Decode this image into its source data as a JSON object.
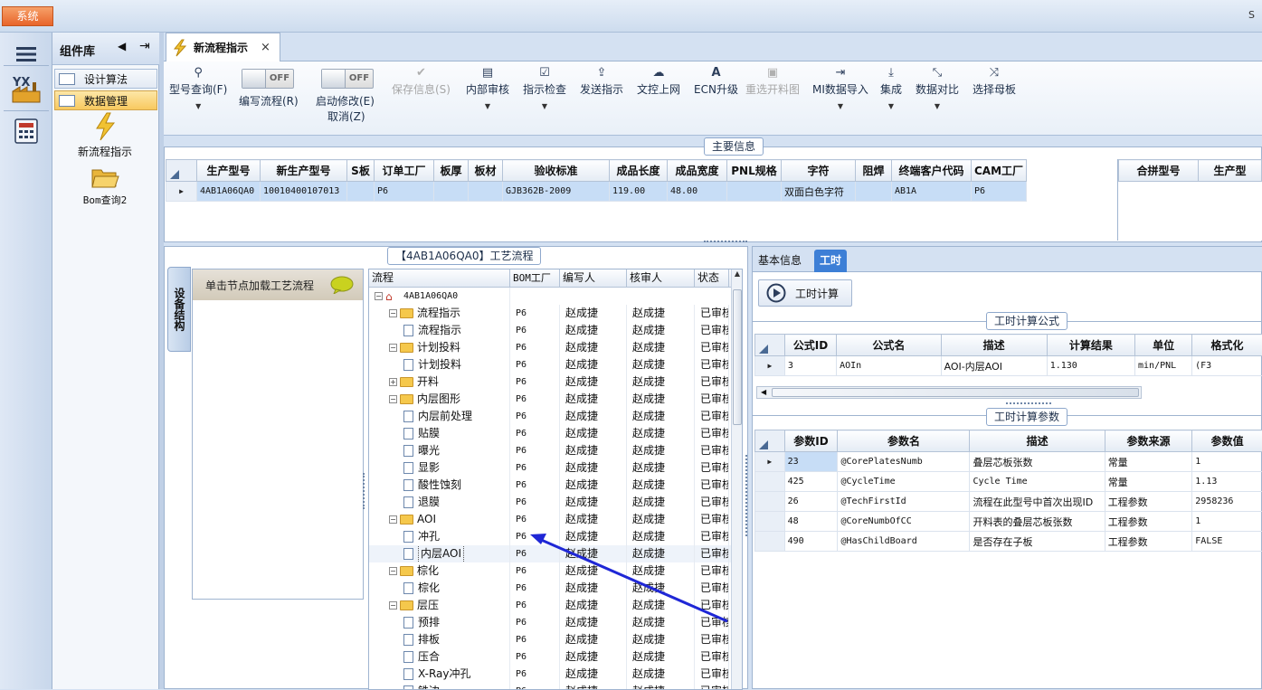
{
  "app": {
    "system_button": "系统",
    "corner_text": "S"
  },
  "component_panel": {
    "title": "组件库",
    "menu": [
      {
        "label": "设计算法"
      },
      {
        "label": "数据管理"
      }
    ],
    "desktop_items": [
      {
        "label": "新流程指示"
      },
      {
        "label": "Bom查询2"
      }
    ]
  },
  "document_tab": {
    "title": "新流程指示",
    "close": "×"
  },
  "toolbar": {
    "model_query": "型号查询(F)",
    "edit_flow": "编写流程(R)",
    "edit_flow_toggle": "OFF",
    "start_modify": "启动修改(E)",
    "start_modify_toggle": "OFF",
    "cancel": "取消(Z)",
    "save_info": "保存信息(S)",
    "internal_review": "内部审核",
    "instruction_check": "指示检查",
    "send_instruction": "发送指示",
    "upload": "文控上网",
    "ecn_upgrade": "ECN升级",
    "reselect_panel": "重选开料图",
    "mi_import": "MI数据导入",
    "integrate": "集成",
    "data_compare": "数据对比",
    "select_mother_board": "选择母板"
  },
  "main_info": {
    "title": "主要信息",
    "columns": [
      "生产型号",
      "新生产型号",
      "S板",
      "订单工厂",
      "板厚",
      "板材",
      "验收标准",
      "成品长度",
      "成品宽度",
      "PNL规格",
      "字符",
      "阻焊",
      "终端客户代码",
      "CAM工厂"
    ],
    "row": [
      "4AB1A06QA0",
      "10010400107013",
      "",
      "P6",
      "",
      "",
      "GJB362B-2009",
      "119.00",
      "48.00",
      "",
      "双面白色字符",
      "",
      "AB1A",
      "P6"
    ],
    "side_columns": [
      "合拼型号",
      "生产型"
    ]
  },
  "process_flow": {
    "title": "【4AB1A06QA0】工艺流程",
    "vertical_tab": "设备结构",
    "tree_header_hint": "单击节点加载工艺流程",
    "columns": [
      "流程",
      "BOM工厂",
      "编写人",
      "核审人",
      "状态"
    ],
    "root": "4AB1A06QA0",
    "rows": [
      {
        "name": "流程指示",
        "type": "folder",
        "level": 1,
        "exp": "−",
        "factory": "P6",
        "writer": "赵成捷",
        "reviewer": "赵成捷",
        "status": "已审核"
      },
      {
        "name": "流程指示",
        "type": "doc",
        "level": 2,
        "exp": "",
        "factory": "P6",
        "writer": "赵成捷",
        "reviewer": "赵成捷",
        "status": "已审核"
      },
      {
        "name": "计划投料",
        "type": "folder",
        "level": 1,
        "exp": "−",
        "factory": "P6",
        "writer": "赵成捷",
        "reviewer": "赵成捷",
        "status": "已审核"
      },
      {
        "name": "计划投料",
        "type": "doc",
        "level": 2,
        "exp": "",
        "factory": "P6",
        "writer": "赵成捷",
        "reviewer": "赵成捷",
        "status": "已审核"
      },
      {
        "name": "开料",
        "type": "folder",
        "level": 1,
        "exp": "+",
        "factory": "P6",
        "writer": "赵成捷",
        "reviewer": "赵成捷",
        "status": "已审核"
      },
      {
        "name": "内层图形",
        "type": "folder",
        "level": 1,
        "exp": "−",
        "factory": "P6",
        "writer": "赵成捷",
        "reviewer": "赵成捷",
        "status": "已审核"
      },
      {
        "name": "内层前处理",
        "type": "doc",
        "level": 2,
        "exp": "",
        "factory": "P6",
        "writer": "赵成捷",
        "reviewer": "赵成捷",
        "status": "已审核"
      },
      {
        "name": "贴膜",
        "type": "doc",
        "level": 2,
        "exp": "",
        "factory": "P6",
        "writer": "赵成捷",
        "reviewer": "赵成捷",
        "status": "已审核"
      },
      {
        "name": "曝光",
        "type": "doc",
        "level": 2,
        "exp": "",
        "factory": "P6",
        "writer": "赵成捷",
        "reviewer": "赵成捷",
        "status": "已审核"
      },
      {
        "name": "显影",
        "type": "doc",
        "level": 2,
        "exp": "",
        "factory": "P6",
        "writer": "赵成捷",
        "reviewer": "赵成捷",
        "status": "已审核"
      },
      {
        "name": "酸性蚀刻",
        "type": "doc",
        "level": 2,
        "exp": "",
        "factory": "P6",
        "writer": "赵成捷",
        "reviewer": "赵成捷",
        "status": "已审核"
      },
      {
        "name": "退膜",
        "type": "doc",
        "level": 2,
        "exp": "",
        "factory": "P6",
        "writer": "赵成捷",
        "reviewer": "赵成捷",
        "status": "已审核"
      },
      {
        "name": "AOI",
        "type": "folder",
        "level": 1,
        "exp": "−",
        "factory": "P6",
        "writer": "赵成捷",
        "reviewer": "赵成捷",
        "status": "已审核"
      },
      {
        "name": "冲孔",
        "type": "doc",
        "level": 2,
        "exp": "",
        "factory": "P6",
        "writer": "赵成捷",
        "reviewer": "赵成捷",
        "status": "已审核"
      },
      {
        "name": "内层AOI",
        "type": "doc",
        "level": 2,
        "exp": "",
        "factory": "P6",
        "writer": "赵成捷",
        "reviewer": "赵成捷",
        "status": "已审核",
        "selected": true
      },
      {
        "name": "棕化",
        "type": "folder",
        "level": 1,
        "exp": "−",
        "factory": "P6",
        "writer": "赵成捷",
        "reviewer": "赵成捷",
        "status": "已审核"
      },
      {
        "name": "棕化",
        "type": "doc",
        "level": 2,
        "exp": "",
        "factory": "P6",
        "writer": "赵成捷",
        "reviewer": "赵成捷",
        "status": "已审核"
      },
      {
        "name": "层压",
        "type": "folder",
        "level": 1,
        "exp": "−",
        "factory": "P6",
        "writer": "赵成捷",
        "reviewer": "赵成捷",
        "status": "已审核"
      },
      {
        "name": "预排",
        "type": "doc",
        "level": 2,
        "exp": "",
        "factory": "P6",
        "writer": "赵成捷",
        "reviewer": "赵成捷",
        "status": "已审核"
      },
      {
        "name": "排板",
        "type": "doc",
        "level": 2,
        "exp": "",
        "factory": "P6",
        "writer": "赵成捷",
        "reviewer": "赵成捷",
        "status": "已审核"
      },
      {
        "name": "压合",
        "type": "doc",
        "level": 2,
        "exp": "",
        "factory": "P6",
        "writer": "赵成捷",
        "reviewer": "赵成捷",
        "status": "已审核"
      },
      {
        "name": "X-Ray冲孔",
        "type": "doc",
        "level": 2,
        "exp": "",
        "factory": "P6",
        "writer": "赵成捷",
        "reviewer": "赵成捷",
        "status": "已审核"
      },
      {
        "name": "铣边",
        "type": "doc",
        "level": 2,
        "exp": "",
        "factory": "P6",
        "writer": "赵成捷",
        "reviewer": "赵成捷",
        "status": "已审核"
      }
    ]
  },
  "right_panel": {
    "tabs": [
      "基本信息",
      "工时"
    ],
    "active_tab": "工时",
    "calc_button": "工时计算",
    "formula": {
      "title": "工时计算公式",
      "columns": [
        "公式ID",
        "公式名",
        "描述",
        "计算结果",
        "单位",
        "格式化"
      ],
      "rows": [
        [
          "3",
          "AOIn",
          "AOI-内层AOI",
          "1.130",
          "min/PNL",
          "(F3"
        ]
      ]
    },
    "params": {
      "title": "工时计算参数",
      "columns": [
        "参数ID",
        "参数名",
        "描述",
        "参数来源",
        "参数值"
      ],
      "rows": [
        [
          "23",
          "@CorePlatesNumb",
          "叠层芯板张数",
          "常量",
          "1"
        ],
        [
          "425",
          "@CycleTime",
          "Cycle Time",
          "常量",
          "1.13"
        ],
        [
          "26",
          "@TechFirstId",
          "流程在此型号中首次出现ID",
          "工程参数",
          "2958236"
        ],
        [
          "48",
          "@CoreNumbOfCC",
          "开料表的叠层芯板张数",
          "工程参数",
          "1"
        ],
        [
          "490",
          "@HasChildBoard",
          "是否存在子板",
          "工程参数",
          "FALSE"
        ]
      ]
    }
  },
  "colors": {
    "accent": "#3d7fd6",
    "selection": "#c7ddf6",
    "annotation_arrow": "#1f27d6"
  }
}
